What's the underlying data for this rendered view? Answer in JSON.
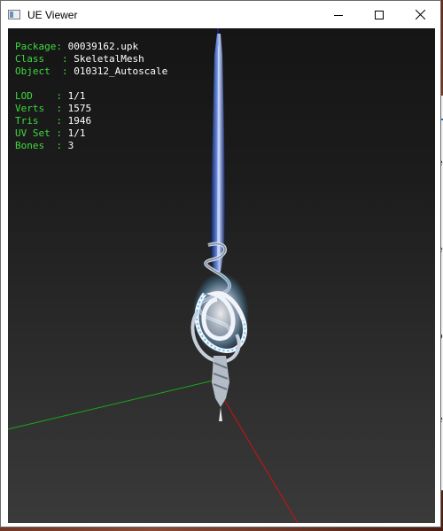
{
  "window": {
    "title": "UE Viewer",
    "controls": {
      "minimize": "minimize",
      "maximize": "maximize",
      "close": "close"
    }
  },
  "info": {
    "package_label": "Package",
    "package_value": "00039162.upk",
    "class_label": "Class",
    "class_value": "SkeletalMesh",
    "object_label": "Object",
    "object_value": "010312_Autoscale",
    "lod_label": "LOD",
    "lod_value": "1/1",
    "verts_label": "Verts",
    "verts_value": "1575",
    "tris_label": "Tris",
    "tris_value": "1946",
    "uvset_label": "UV Set",
    "uvset_value": "1/1",
    "bones_label": "Bones",
    "bones_value": "3"
  },
  "background_marks": [
    "e",
    "e",
    "o",
    "e",
    "o"
  ],
  "colors": {
    "hud_label": "#3fd93f",
    "hud_value": "#ffffff",
    "axis_x": "#d01010",
    "axis_y": "#1aa81a",
    "axis_z": "#1a2ad0"
  }
}
